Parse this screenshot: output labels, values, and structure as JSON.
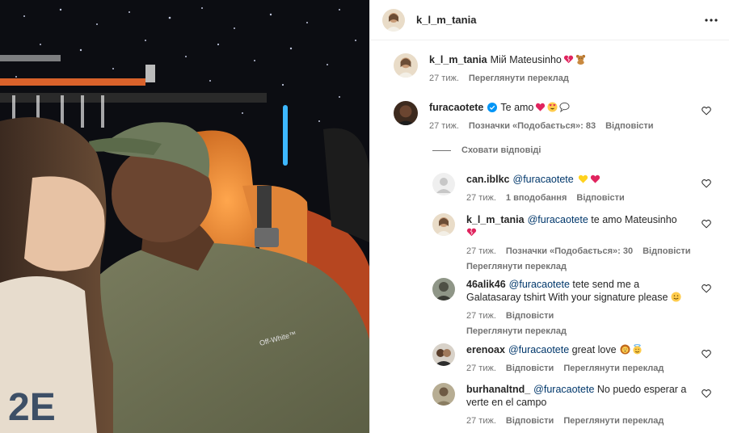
{
  "post": {
    "author": "k_l_m_tania",
    "more_icon": "more-horizontal-icon"
  },
  "caption": {
    "user": "k_l_m_tania",
    "text": "Мій Mateusinho",
    "time": "27 тиж.",
    "see_translation": "Переглянути переклад"
  },
  "comments": [
    {
      "user": "furacaotete",
      "verified": true,
      "text": "Te amo",
      "time": "27 тиж.",
      "likes": "Позначки «Подобається»: 83",
      "reply": "Відповісти"
    }
  ],
  "hide_replies": "Сховати відповіді",
  "replies": [
    {
      "user": "can.iblkc",
      "mention": "@furacaotete",
      "text": "",
      "time": "27 тиж.",
      "likes": "1 вподобання",
      "reply": "Відповісти"
    },
    {
      "user": "k_l_m_tania",
      "mention": "@furacaotete",
      "text": "te amo Mateusinho",
      "time": "27 тиж.",
      "likes": "Позначки «Подобається»: 30",
      "reply": "Відповісти",
      "see_translation": "Переглянути переклад"
    },
    {
      "user": "46alik46",
      "mention": "@furacaotete",
      "text_line1": "tete send me a",
      "text_line2": "Galatasaray tshirt With your signature please",
      "time": "27 тиж.",
      "reply": "Відповісти",
      "see_translation": "Переглянути переклад"
    },
    {
      "user": "erenoax",
      "mention": "@furacaotete",
      "text": "great love",
      "time": "27 тиж.",
      "reply": "Відповісти",
      "see_translation": "Переглянути переклад"
    },
    {
      "user": "burhanaltnd_",
      "mention": "@furacaotete",
      "text_line1": "No puedo esperar a",
      "text_line2": "verte en el campo",
      "time": "27 тиж.",
      "reply": "Відповісти",
      "see_translation": "Переглянути переклад"
    }
  ],
  "colors": {
    "mention": "#00376b",
    "meta": "#737373",
    "verified": "#0095f6"
  }
}
